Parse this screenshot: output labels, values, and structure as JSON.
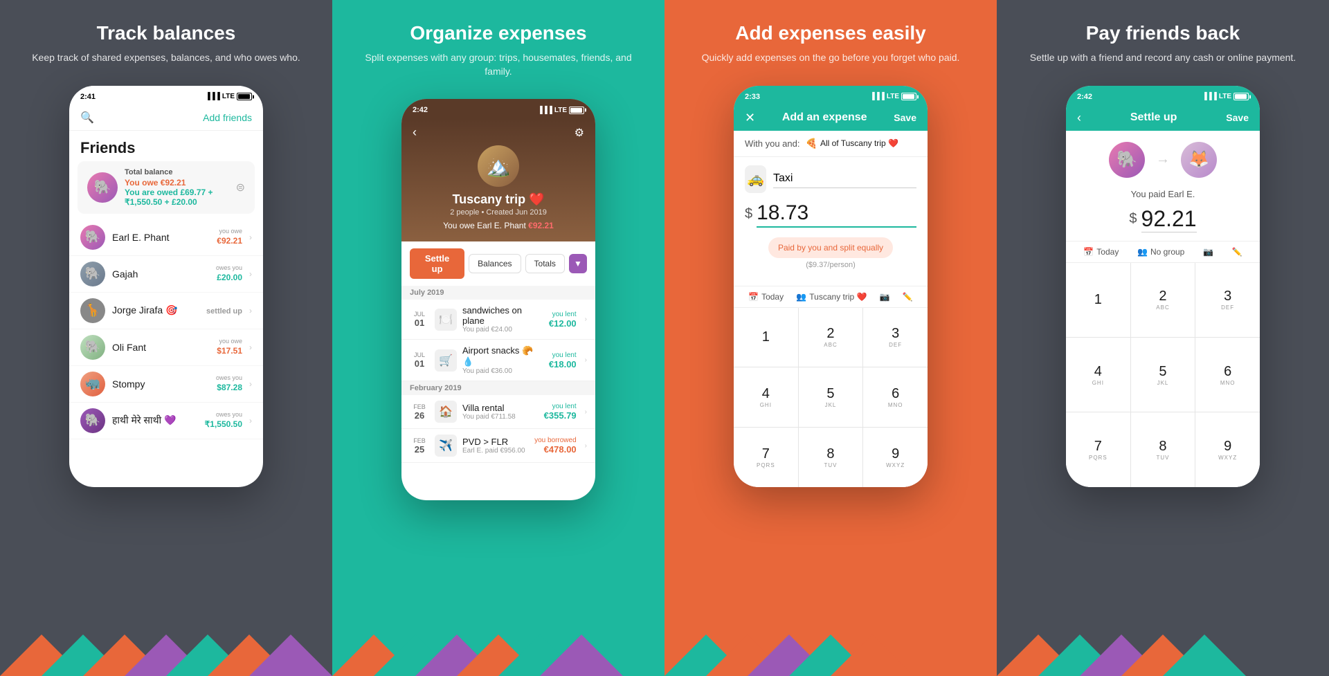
{
  "panel1": {
    "title": "Track balances",
    "subtitle": "Keep track of shared expenses, balances, and who owes who.",
    "status_time": "2:41",
    "screen": {
      "search_placeholder": "🔍",
      "add_friends": "Add friends",
      "section_title": "Friends",
      "balance_card": {
        "title": "Total balance",
        "owe": "You owe €92.21",
        "owed": "You are owed £69.77 + ₹1,550.50 + £20.00"
      },
      "friends": [
        {
          "name": "Earl E. Phant",
          "amount": "€92.21",
          "type": "owe",
          "label": "you owe",
          "emoji": "🐘"
        },
        {
          "name": "Gajah",
          "amount": "£20.00",
          "type": "owed",
          "label": "owes you",
          "emoji": "🐘"
        },
        {
          "name": "Jorge Jirafa 🎯",
          "amount": "settled up",
          "type": "settled",
          "label": "",
          "emoji": "🦒"
        },
        {
          "name": "Oli Fant",
          "amount": "$17.51",
          "type": "owe",
          "label": "you owe",
          "emoji": "🐘"
        },
        {
          "name": "Stompy",
          "amount": "$87.28",
          "type": "owed",
          "label": "owes you",
          "emoji": "🦏"
        },
        {
          "name": "हाथी मेरे साथी 💜",
          "amount": "₹1,550.50",
          "type": "owed",
          "label": "owes you",
          "emoji": "🐘"
        }
      ]
    }
  },
  "panel2": {
    "title": "Organize expenses",
    "subtitle": "Split expenses with any group: trips, housemates, friends, and family.",
    "status_time": "2:42",
    "screen": {
      "group_name": "Tuscany trip ❤️",
      "group_meta": "2 people • Created Jun 2019",
      "owe_text": "You owe Earl E. Phant",
      "owe_amount": "€92.21",
      "settle_btn": "Settle up",
      "tab_balances": "Balances",
      "tab_totals": "Totals",
      "months": [
        {
          "label": "July 2019",
          "expenses": [
            {
              "month": "Jul",
              "day": "01",
              "icon": "🍽️",
              "name": "sandwiches on plane",
              "sub": "You paid €24.00",
              "type": "lent",
              "label": "you lent",
              "amount": "€12.00"
            },
            {
              "month": "Jul",
              "day": "01",
              "icon": "🛒",
              "name": "Airport snacks 🥐💧",
              "sub": "You paid €36.00",
              "type": "lent",
              "label": "you lent",
              "amount": "€18.00"
            }
          ]
        },
        {
          "label": "February 2019",
          "expenses": [
            {
              "month": "Feb",
              "day": "26",
              "icon": "🏠",
              "name": "Villa rental",
              "sub": "You paid €711.58",
              "type": "lent",
              "label": "you lent",
              "amount": "€355.79"
            },
            {
              "month": "Feb",
              "day": "25",
              "icon": "✈️",
              "name": "PVD > FLR",
              "sub": "Earl E. paid €956.00",
              "type": "borrowed",
              "label": "you borrowed",
              "amount": "€478.00"
            }
          ]
        }
      ]
    }
  },
  "panel3": {
    "title": "Add expenses easily",
    "subtitle": "Quickly add expenses on the go before you forget who paid.",
    "status_time": "2:33",
    "screen": {
      "header_title": "Add an expense",
      "save_btn": "Save",
      "with_label": "With you and:",
      "with_group": "All of Tuscany trip ❤️",
      "expense_name": "Taxi",
      "currency": "$",
      "amount": "18.73",
      "split_label": "Paid by you and split equally",
      "per_person": "($9.37/person)",
      "date_label": "Today",
      "group_label": "Tuscany trip ❤️",
      "numpad": [
        {
          "num": "1",
          "alpha": ""
        },
        {
          "num": "2",
          "alpha": "ABC"
        },
        {
          "num": "3",
          "alpha": "DEF"
        },
        {
          "num": "4",
          "alpha": "GHI"
        },
        {
          "num": "5",
          "alpha": "JKL"
        },
        {
          "num": "6",
          "alpha": "MNO"
        },
        {
          "num": "7",
          "alpha": "PQRS"
        },
        {
          "num": "8",
          "alpha": "TUV"
        },
        {
          "num": "9",
          "alpha": "WXYZ"
        }
      ]
    }
  },
  "panel4": {
    "title": "Pay friends back",
    "subtitle": "Settle up with a friend and record any cash or online payment.",
    "status_time": "2:42",
    "screen": {
      "header_title": "Settle up",
      "save_btn": "Save",
      "paid_label": "You paid Earl E.",
      "currency": "$",
      "amount": "92.21",
      "date_label": "Today",
      "group_label": "No group",
      "numpad": [
        {
          "num": "1",
          "alpha": ""
        },
        {
          "num": "2",
          "alpha": "ABC"
        },
        {
          "num": "3",
          "alpha": "DEF"
        },
        {
          "num": "4",
          "alpha": "GHI"
        },
        {
          "num": "5",
          "alpha": "JKL"
        },
        {
          "num": "6",
          "alpha": "MNO"
        },
        {
          "num": "7",
          "alpha": "PQRS"
        },
        {
          "num": "8",
          "alpha": "TUV"
        },
        {
          "num": "9",
          "alpha": "WXYZ"
        }
      ]
    }
  }
}
